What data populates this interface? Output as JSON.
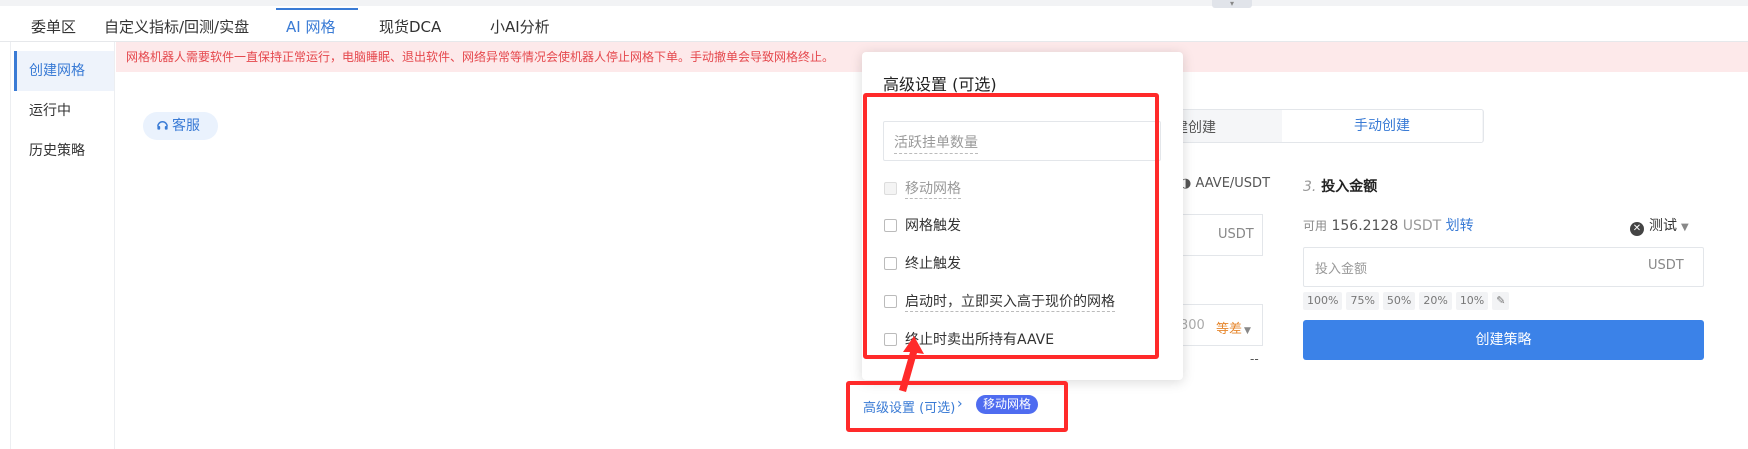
{
  "tabs": [
    {
      "label": "委单区"
    },
    {
      "label": "自定义指标/回测/实盘"
    },
    {
      "label": "AI 网格"
    },
    {
      "label": "现货DCA"
    },
    {
      "label": "小AI分析"
    }
  ],
  "sidebar": {
    "items": [
      {
        "label": "创建网格"
      },
      {
        "label": "运行中"
      },
      {
        "label": "历史策略"
      }
    ]
  },
  "warning": "网格机器人需要软件一直保持正常运行，电脑睡眠、退出软件、网络异常等情况会使机器人停止网格下单。手动撤单会导致网格终止。",
  "service_button": "客服",
  "mode": {
    "auto_partial": "建创建",
    "manual": "手动创建"
  },
  "pair": "AAVE/USDT",
  "usdt_field_unit": "USDT",
  "range": {
    "value": "300",
    "mode": "等差"
  },
  "dash": "--",
  "invest": {
    "step_num": "3.",
    "title": "投入金额",
    "available_label": "可用",
    "available_value": "156.2128",
    "available_unit": "USDT",
    "transfer_link": "划转",
    "account": "测试",
    "amount_placeholder": "投入金额",
    "amount_unit": "USDT",
    "percents": [
      "100%",
      "75%",
      "50%",
      "20%",
      "10%"
    ],
    "create_button": "创建策略"
  },
  "popup": {
    "title": "高级设置 (可选)",
    "active_orders_placeholder": "活跃挂单数量",
    "options": [
      {
        "label": "移动网格",
        "disabled": true
      },
      {
        "label": "网格触发",
        "disabled": false
      },
      {
        "label": "终止触发",
        "disabled": false
      },
      {
        "label": "启动时，立即买入高于现价的网格",
        "disabled": false
      },
      {
        "label": "终止时卖出所持有AAVE",
        "disabled": false
      }
    ]
  },
  "breadcrumb": {
    "advanced_link": "高级设置 (可选)",
    "tag": "移动网格"
  },
  "colors": {
    "accent": "#3a7bd5",
    "annotation": "#ff2a2a",
    "warning_text": "#e5484d",
    "tag_bg": "#4f6cf0"
  }
}
